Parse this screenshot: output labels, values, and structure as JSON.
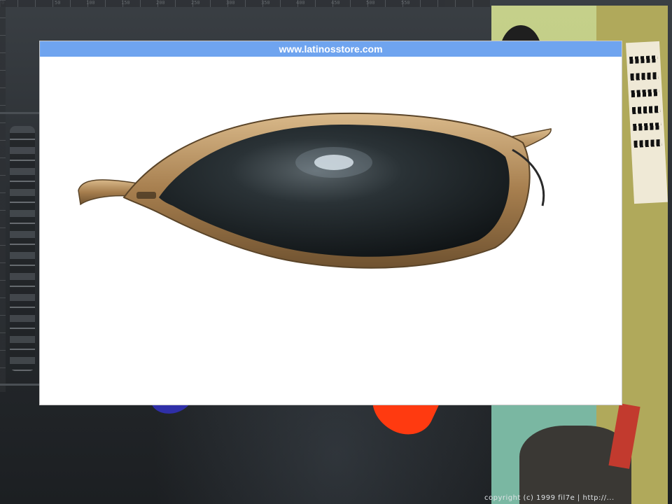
{
  "background": {
    "ruler_labels": [
      "0",
      "50",
      "100",
      "150",
      "200",
      "250",
      "300",
      "350",
      "400",
      "450",
      "500",
      "550"
    ],
    "accent_blue": "#2f2fa8",
    "accent_red": "#ff3a10"
  },
  "poster": {
    "credit": "copyright (c) 1999 fil7e | http://..."
  },
  "window": {
    "url": "www.latinosstore.com",
    "bar_color": "#6fa4ef",
    "image": "sunglasses-product-image",
    "frame_color": "#b08a55",
    "lens_color": "#20272b"
  }
}
